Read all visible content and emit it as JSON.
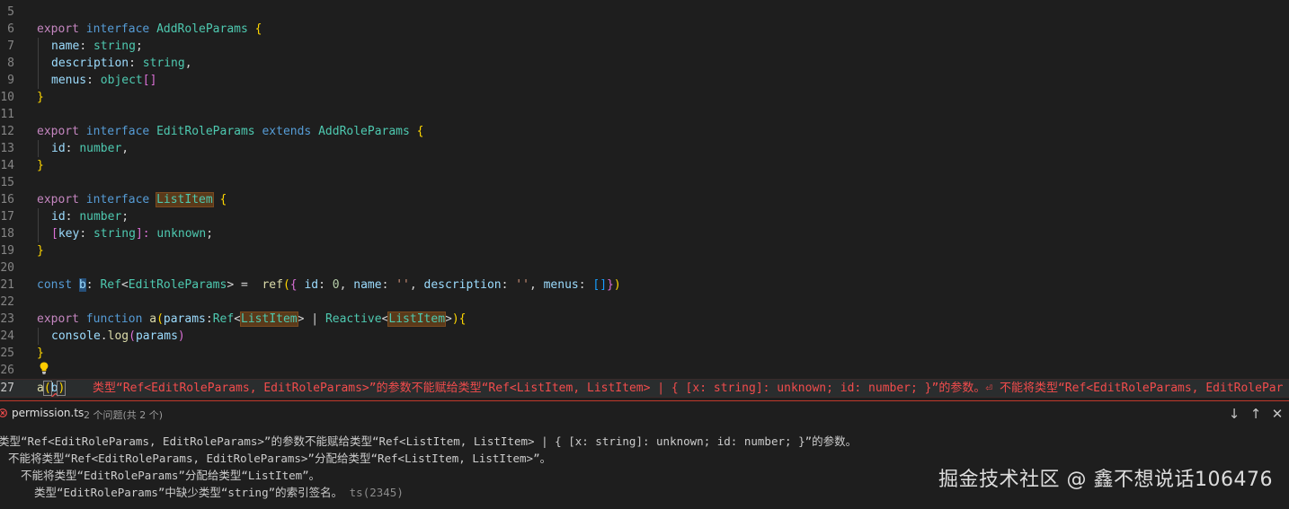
{
  "editor": {
    "line_numbers": [
      "5",
      "6",
      "7",
      "8",
      "9",
      "10",
      "11",
      "12",
      "13",
      "14",
      "15",
      "16",
      "17",
      "18",
      "19",
      "20",
      "21",
      "22",
      "23",
      "24",
      "25",
      "26",
      "27"
    ],
    "lines": {
      "l6": {
        "a": "export",
        "b": " interface ",
        "c": "AddRoleParams",
        "d": " {"
      },
      "l7": {
        "a": "name",
        "b": ": ",
        "c": "string",
        "d": ";"
      },
      "l8": {
        "a": "description",
        "b": ": ",
        "c": "string",
        "d": ","
      },
      "l9": {
        "a": "menus",
        "b": ": ",
        "c": "object",
        "d": "[]"
      },
      "l10": {
        "a": "}"
      },
      "l12": {
        "a": "export",
        "b": " interface ",
        "c": "EditRoleParams",
        "d": " extends ",
        "e": "AddRoleParams",
        "f": " {"
      },
      "l13": {
        "a": "id",
        "b": ": ",
        "c": "number",
        "d": ","
      },
      "l14": {
        "a": "}"
      },
      "l16": {
        "a": "export",
        "b": " interface ",
        "c": "ListItem",
        "d": " {"
      },
      "l17": {
        "a": "id",
        "b": ": ",
        "c": "number",
        "d": ";"
      },
      "l18": {
        "a": "[",
        "b": "key",
        "c": ": ",
        "d": "string",
        "e": "]: ",
        "f": "unknown",
        "g": ";"
      },
      "l19": {
        "a": "}"
      },
      "l21": {
        "a": "const",
        "b": " ",
        "c": "b",
        "d": ": ",
        "e": "Ref",
        "f": "<",
        "g": "EditRoleParams",
        "h": "> =  ",
        "i": "ref",
        "j": "(",
        "k": "{ ",
        "l": "id",
        "m": ": ",
        "n": "0",
        "o": ", ",
        "p": "name",
        "q": ": ",
        "r": "''",
        "s": ", ",
        "t": "description",
        "u": ": ",
        "v": "''",
        "w": ", ",
        "x": "menus",
        "y": ": ",
        "z": "[]",
        "aa": "}",
        "ab": ")"
      },
      "l23": {
        "a": "export",
        "b": " function ",
        "c": "a",
        "d": "(",
        "e": "params",
        "f": ":",
        "g": "Ref",
        "h": "<",
        "i": "ListItem",
        "j": "> | ",
        "k": "Reactive",
        "l": "<",
        "m": "ListItem",
        "n": ">",
        "o": "){"
      },
      "l24": {
        "a": "console",
        "b": ".",
        "c": "log",
        "d": "(",
        "e": "params",
        "f": ")"
      },
      "l25": {
        "a": "}"
      },
      "l27": {
        "a": "a",
        "b": "(",
        "c": "b",
        "d": ")"
      }
    },
    "inline_error": "类型“Ref<EditRoleParams, EditRoleParams>”的参数不能赋给类型“Ref<ListItem, ListItem> | { [x: string]: unknown; id: number; }”的参数。⏎ 不能将类型“Ref<EditRoleParams, EditRolePar"
  },
  "problems": {
    "file": "permission.ts",
    "count": "2 个问题(共 2 个)",
    "actions": {
      "next": "↓",
      "prev": "↑",
      "close": "✕"
    },
    "messages": [
      "类型“Ref<EditRoleParams, EditRoleParams>”的参数不能赋给类型“Ref<ListItem, ListItem> | { [x: string]: unknown; id: number; }”的参数。",
      "不能将类型“Ref<EditRoleParams, EditRoleParams>”分配给类型“Ref<ListItem, ListItem>”。",
      "不能将类型“EditRoleParams”分配给类型“ListItem”。",
      "类型“EditRoleParams”中缺少类型“string”的索引签名。"
    ],
    "error_code": "ts(2345)"
  },
  "watermark": "掘金技术社区 @ 鑫不想说话106476",
  "colors": {
    "error": "#f14c4c",
    "keyword": "#569cd6",
    "type": "#4ec9b0",
    "variable": "#9cdcfe"
  }
}
